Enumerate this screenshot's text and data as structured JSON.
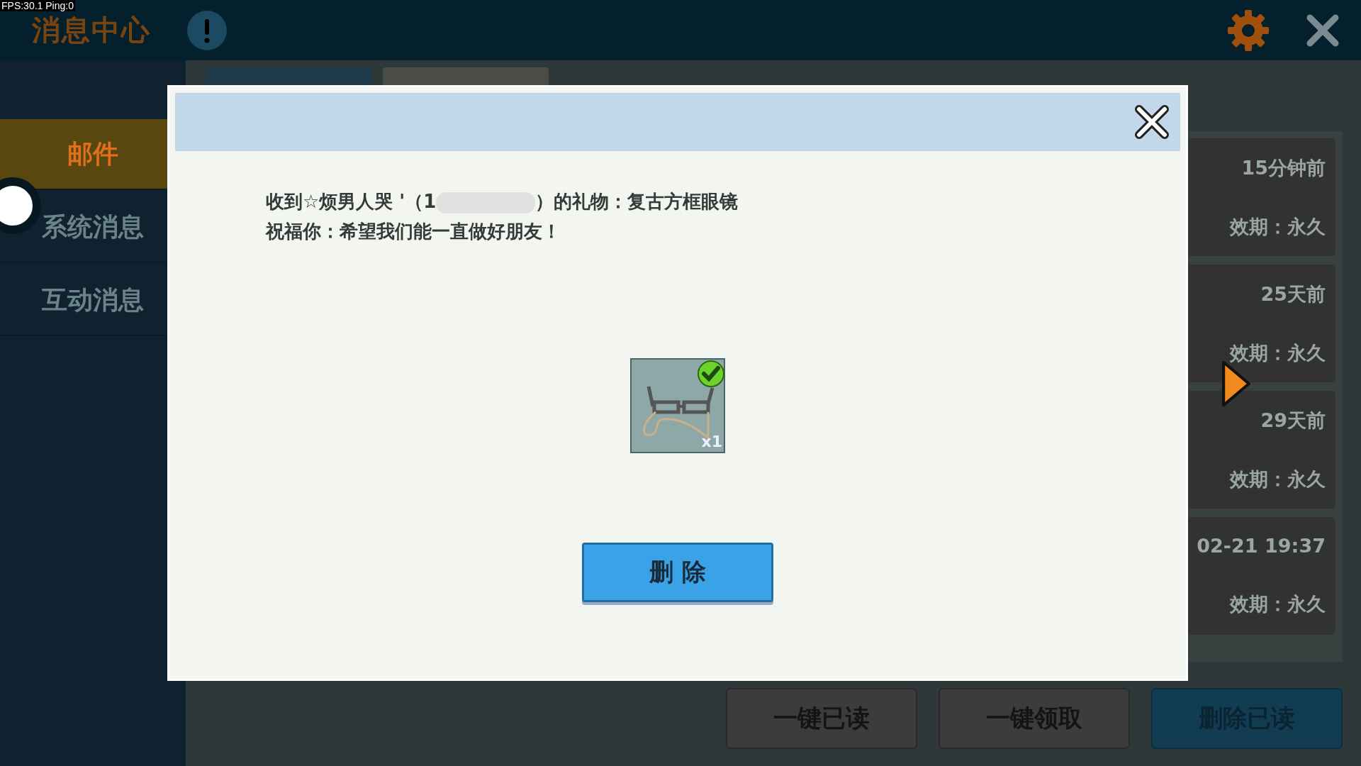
{
  "status_overlay": "FPS:30.1  Ping:0",
  "header": {
    "title": "消息中心"
  },
  "sidebar": {
    "items": [
      {
        "label": "邮件",
        "selected": true
      },
      {
        "label": "系统消息",
        "selected": false
      },
      {
        "label": "互动消息",
        "selected": false
      }
    ]
  },
  "mail_tabs": [
    {
      "selected": true
    },
    {
      "selected": false
    }
  ],
  "mail_list": [
    {
      "time": "15分钟前",
      "validity": "效期：永久"
    },
    {
      "time": "25天前",
      "validity": "效期：永久"
    },
    {
      "time": "29天前",
      "validity": "效期：永久"
    },
    {
      "time": "02-21 19:37",
      "validity": "效期：永久"
    }
  ],
  "actions": [
    {
      "label": "一键已读",
      "kind": "normal"
    },
    {
      "label": "一键领取",
      "kind": "normal"
    },
    {
      "label": "删除已读",
      "kind": "primary"
    }
  ],
  "dialog": {
    "message_start": "收到☆烦男人哭 '（1",
    "message_end": "）的礼物：复古方框眼镜",
    "blessing": "祝福你：希望我们能一直做好朋友！",
    "gift": {
      "quantity": "x1",
      "claimed": true
    },
    "delete_button": "删 除"
  }
}
